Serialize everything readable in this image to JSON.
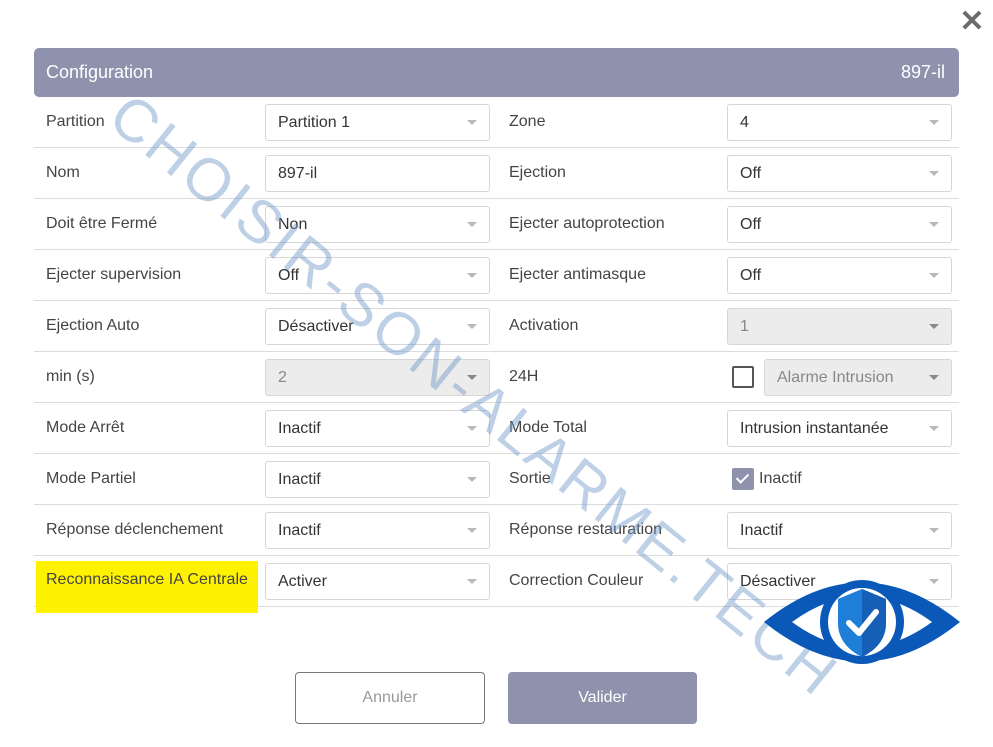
{
  "dialog": {
    "close_icon": "close-icon",
    "title": "Configuration",
    "id": "897-il"
  },
  "rows": [
    {
      "left": {
        "label": "Partition",
        "value": "Partition 1"
      },
      "right": {
        "label": "Zone",
        "value": "4"
      }
    },
    {
      "left": {
        "label": "Nom",
        "value": "897-il"
      },
      "right": {
        "label": "Ejection",
        "value": "Off"
      }
    },
    {
      "left": {
        "label": "Doit être Fermé",
        "value": "Non"
      },
      "right": {
        "label": "Ejecter autoprotection",
        "value": "Off"
      }
    },
    {
      "left": {
        "label": "Ejecter supervision",
        "value": "Off"
      },
      "right": {
        "label": "Ejecter antimasque",
        "value": "Off"
      }
    },
    {
      "left": {
        "label": "Ejection Auto",
        "value": "Désactiver"
      },
      "right": {
        "label": "Activation",
        "value": "1"
      }
    },
    {
      "left": {
        "label": "min (s)",
        "value": "2"
      },
      "right": {
        "label": "24H",
        "value": "Alarme Intrusion",
        "checked": false
      }
    },
    {
      "left": {
        "label": "Mode Arrêt",
        "value": "Inactif"
      },
      "right": {
        "label": "Mode Total",
        "value": "Intrusion instantanée"
      }
    },
    {
      "left": {
        "label": "Mode Partiel",
        "value": "Inactif"
      },
      "right": {
        "label": "Sortie",
        "value": "Inactif",
        "checked": true
      }
    },
    {
      "left": {
        "label": "Réponse déclenchement",
        "value": "Inactif"
      },
      "right": {
        "label": "Réponse restauration",
        "value": "Inactif"
      }
    },
    {
      "left": {
        "label": "Reconnaissance IA Centrale",
        "value": "Activer"
      },
      "right": {
        "label": "Correction Couleur",
        "value": "Désactiver"
      }
    }
  ],
  "buttons": {
    "cancel": "Annuler",
    "ok": "Valider"
  },
  "watermark": "CHOISIR-SON-ALARME.TECH",
  "colors": {
    "accent": "#8e92ad",
    "highlight": "#fff200",
    "disabled": "#ececec"
  }
}
